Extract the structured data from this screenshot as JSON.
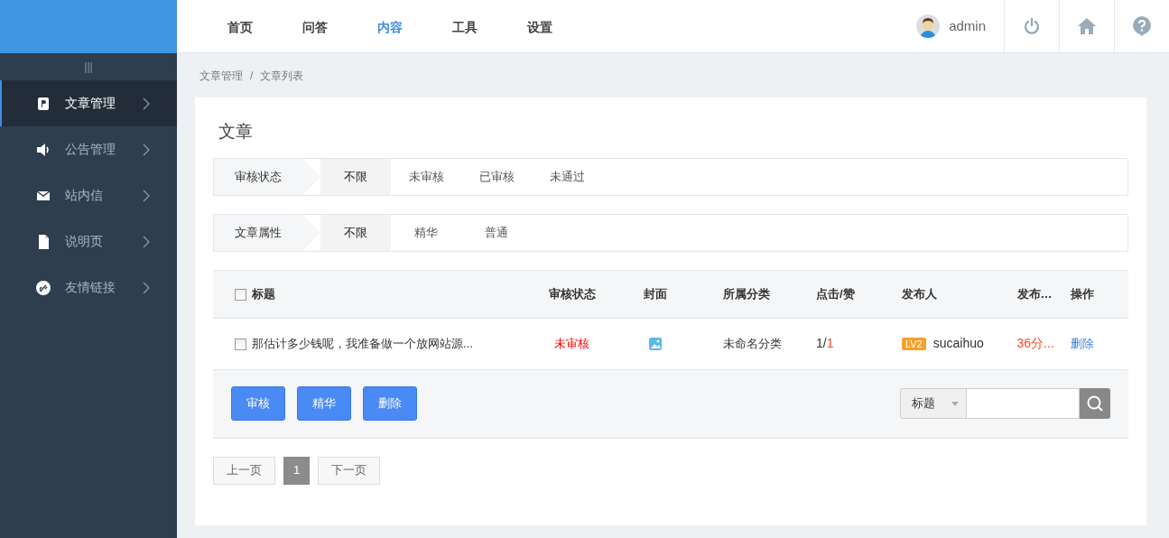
{
  "top_nav": [
    {
      "label": "首页",
      "selected": false
    },
    {
      "label": "问答",
      "selected": false
    },
    {
      "label": "内容",
      "selected": true
    },
    {
      "label": "工具",
      "selected": false
    },
    {
      "label": "设置",
      "selected": false
    }
  ],
  "user": {
    "name": "admin"
  },
  "sidebar": {
    "toggle": "|||",
    "items": [
      {
        "label": "文章管理",
        "kind": "article",
        "selected": true
      },
      {
        "label": "公告管理",
        "kind": "speaker",
        "selected": false
      },
      {
        "label": "站内信",
        "kind": "mail",
        "selected": false
      },
      {
        "label": "说明页",
        "kind": "file",
        "selected": false
      },
      {
        "label": "友情链接",
        "kind": "link",
        "selected": false
      }
    ]
  },
  "breadcrumb": {
    "separator": "/",
    "items": [
      "文章管理",
      "文章列表"
    ]
  },
  "title": "文章",
  "filters": [
    {
      "label": "审核状态",
      "options": [
        {
          "label": "不限",
          "selected": true
        },
        {
          "label": "未审核",
          "selected": false
        },
        {
          "label": "已审核",
          "selected": false
        },
        {
          "label": "未通过",
          "selected": false
        }
      ]
    },
    {
      "label": "文章属性",
      "options": [
        {
          "label": "不限",
          "selected": true
        },
        {
          "label": "精华",
          "selected": false
        },
        {
          "label": "普通",
          "selected": false
        }
      ]
    }
  ],
  "table": {
    "select_all": {
      "checked": false
    },
    "columns": [
      "标题",
      "审核状态",
      "封面",
      "所属分类",
      "点击/赞",
      "发布人",
      "发布…",
      "操作"
    ],
    "rows": [
      {
        "checked": false,
        "title": "那估计多少钱呢，我准备做一个放网站源...",
        "status": "未审核",
        "has_cover": true,
        "category": "未命名分类",
        "clicks": "1",
        "count_separator": "/",
        "likes": "1",
        "level": "LV2",
        "author": "sucaihuo",
        "time": "36分...",
        "action": "删除"
      }
    ]
  },
  "bulk_buttons": [
    "审核",
    "精华",
    "删除"
  ],
  "search": {
    "field": "标题"
  },
  "pagination": [
    {
      "label": "上一页",
      "selected": false
    },
    {
      "label": "1",
      "selected": true
    },
    {
      "label": "下一页",
      "selected": false
    }
  ]
}
